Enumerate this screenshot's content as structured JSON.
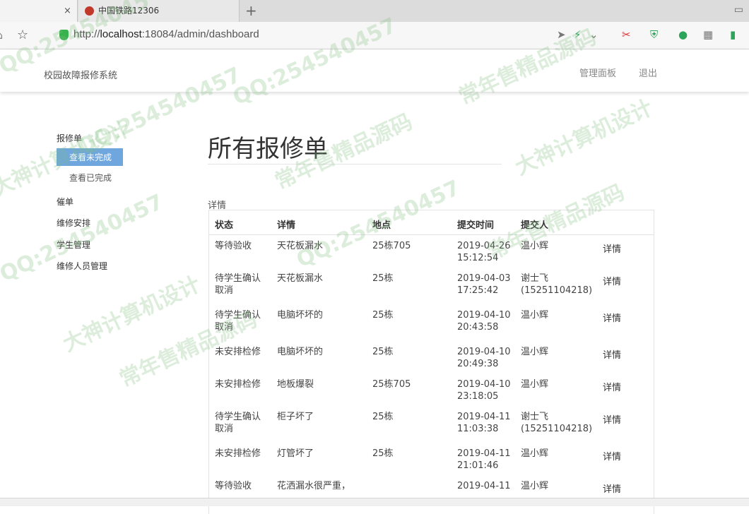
{
  "browser": {
    "tabs": [
      {
        "label": "×",
        "active": true
      },
      {
        "label": "中国铁路12306",
        "active": false
      }
    ],
    "new_tab": "+",
    "url_prefix": "http://",
    "url_host": "localhost",
    "url_rest": ":18084/admin/dashboard"
  },
  "navbar": {
    "brand": "校园故障报修系统",
    "links": [
      "管理面板",
      "退出"
    ]
  },
  "sidebar": {
    "groups": [
      {
        "label": "报修单",
        "items": [
          "查看未完成",
          "查看已完成"
        ]
      },
      {
        "label": "催单"
      },
      {
        "label": "维修安排"
      },
      {
        "label": "学生管理"
      },
      {
        "label": "维修人员管理"
      }
    ]
  },
  "main": {
    "title": "所有报修单",
    "caption": "详情",
    "table": {
      "headers": [
        "状态",
        "详情",
        "地点",
        "提交时间",
        "提交人"
      ],
      "rows": [
        {
          "status": "等待验收",
          "detail": "天花板漏水",
          "place": "25栋705",
          "time": "2019-04-26\n15:12:54",
          "user": "温小辉",
          "action": "详情"
        },
        {
          "status": "待学生确认\n取消",
          "detail": "天花板漏水",
          "place": "25栋",
          "time": "2019-04-03\n17:25:42",
          "user": "谢士飞\n(15251104218)",
          "action": "详情"
        },
        {
          "status": "待学生确认\n取消",
          "detail": "电脑坏坏的",
          "place": "25栋",
          "time": "2019-04-10\n20:43:58",
          "user": "温小辉",
          "action": "详情"
        },
        {
          "status": "未安排检修",
          "detail": "电脑坏坏的",
          "place": "25栋",
          "time": "2019-04-10\n20:49:38",
          "user": "温小辉",
          "action": "详情"
        },
        {
          "status": "未安排检修",
          "detail": "地板爆裂",
          "place": "25栋705",
          "time": "2019-04-10\n23:18:05",
          "user": "温小辉",
          "action": "详情"
        },
        {
          "status": "待学生确认\n取消",
          "detail": "柜子坏了",
          "place": "25栋",
          "time": "2019-04-11\n11:03:38",
          "user": "谢士飞\n(15251104218)",
          "action": "详情"
        },
        {
          "status": "未安排检修",
          "detail": "灯管坏了",
          "place": "25栋",
          "time": "2019-04-11\n21:01:46",
          "user": "温小辉",
          "action": "详情"
        },
        {
          "status": "等待验收",
          "detail": "花洒漏水很严重，",
          "place": "",
          "time": "2019-04-11",
          "user": "温小辉",
          "action": "详情"
        }
      ]
    }
  },
  "watermarks": [
    "QQ:25454045",
    "QQ:254540457",
    "常年售精品源码",
    "大神计算机设计",
    "QQ:254540457",
    "常年售精品源码",
    "大神计算机设计",
    "QQ:254540457",
    "常年售精品源码",
    "QQ:254540457",
    "大神计算机设计",
    "常年售精品源码"
  ],
  "colors": {
    "accent": "#6fa6de",
    "watermark": "#82be82"
  }
}
